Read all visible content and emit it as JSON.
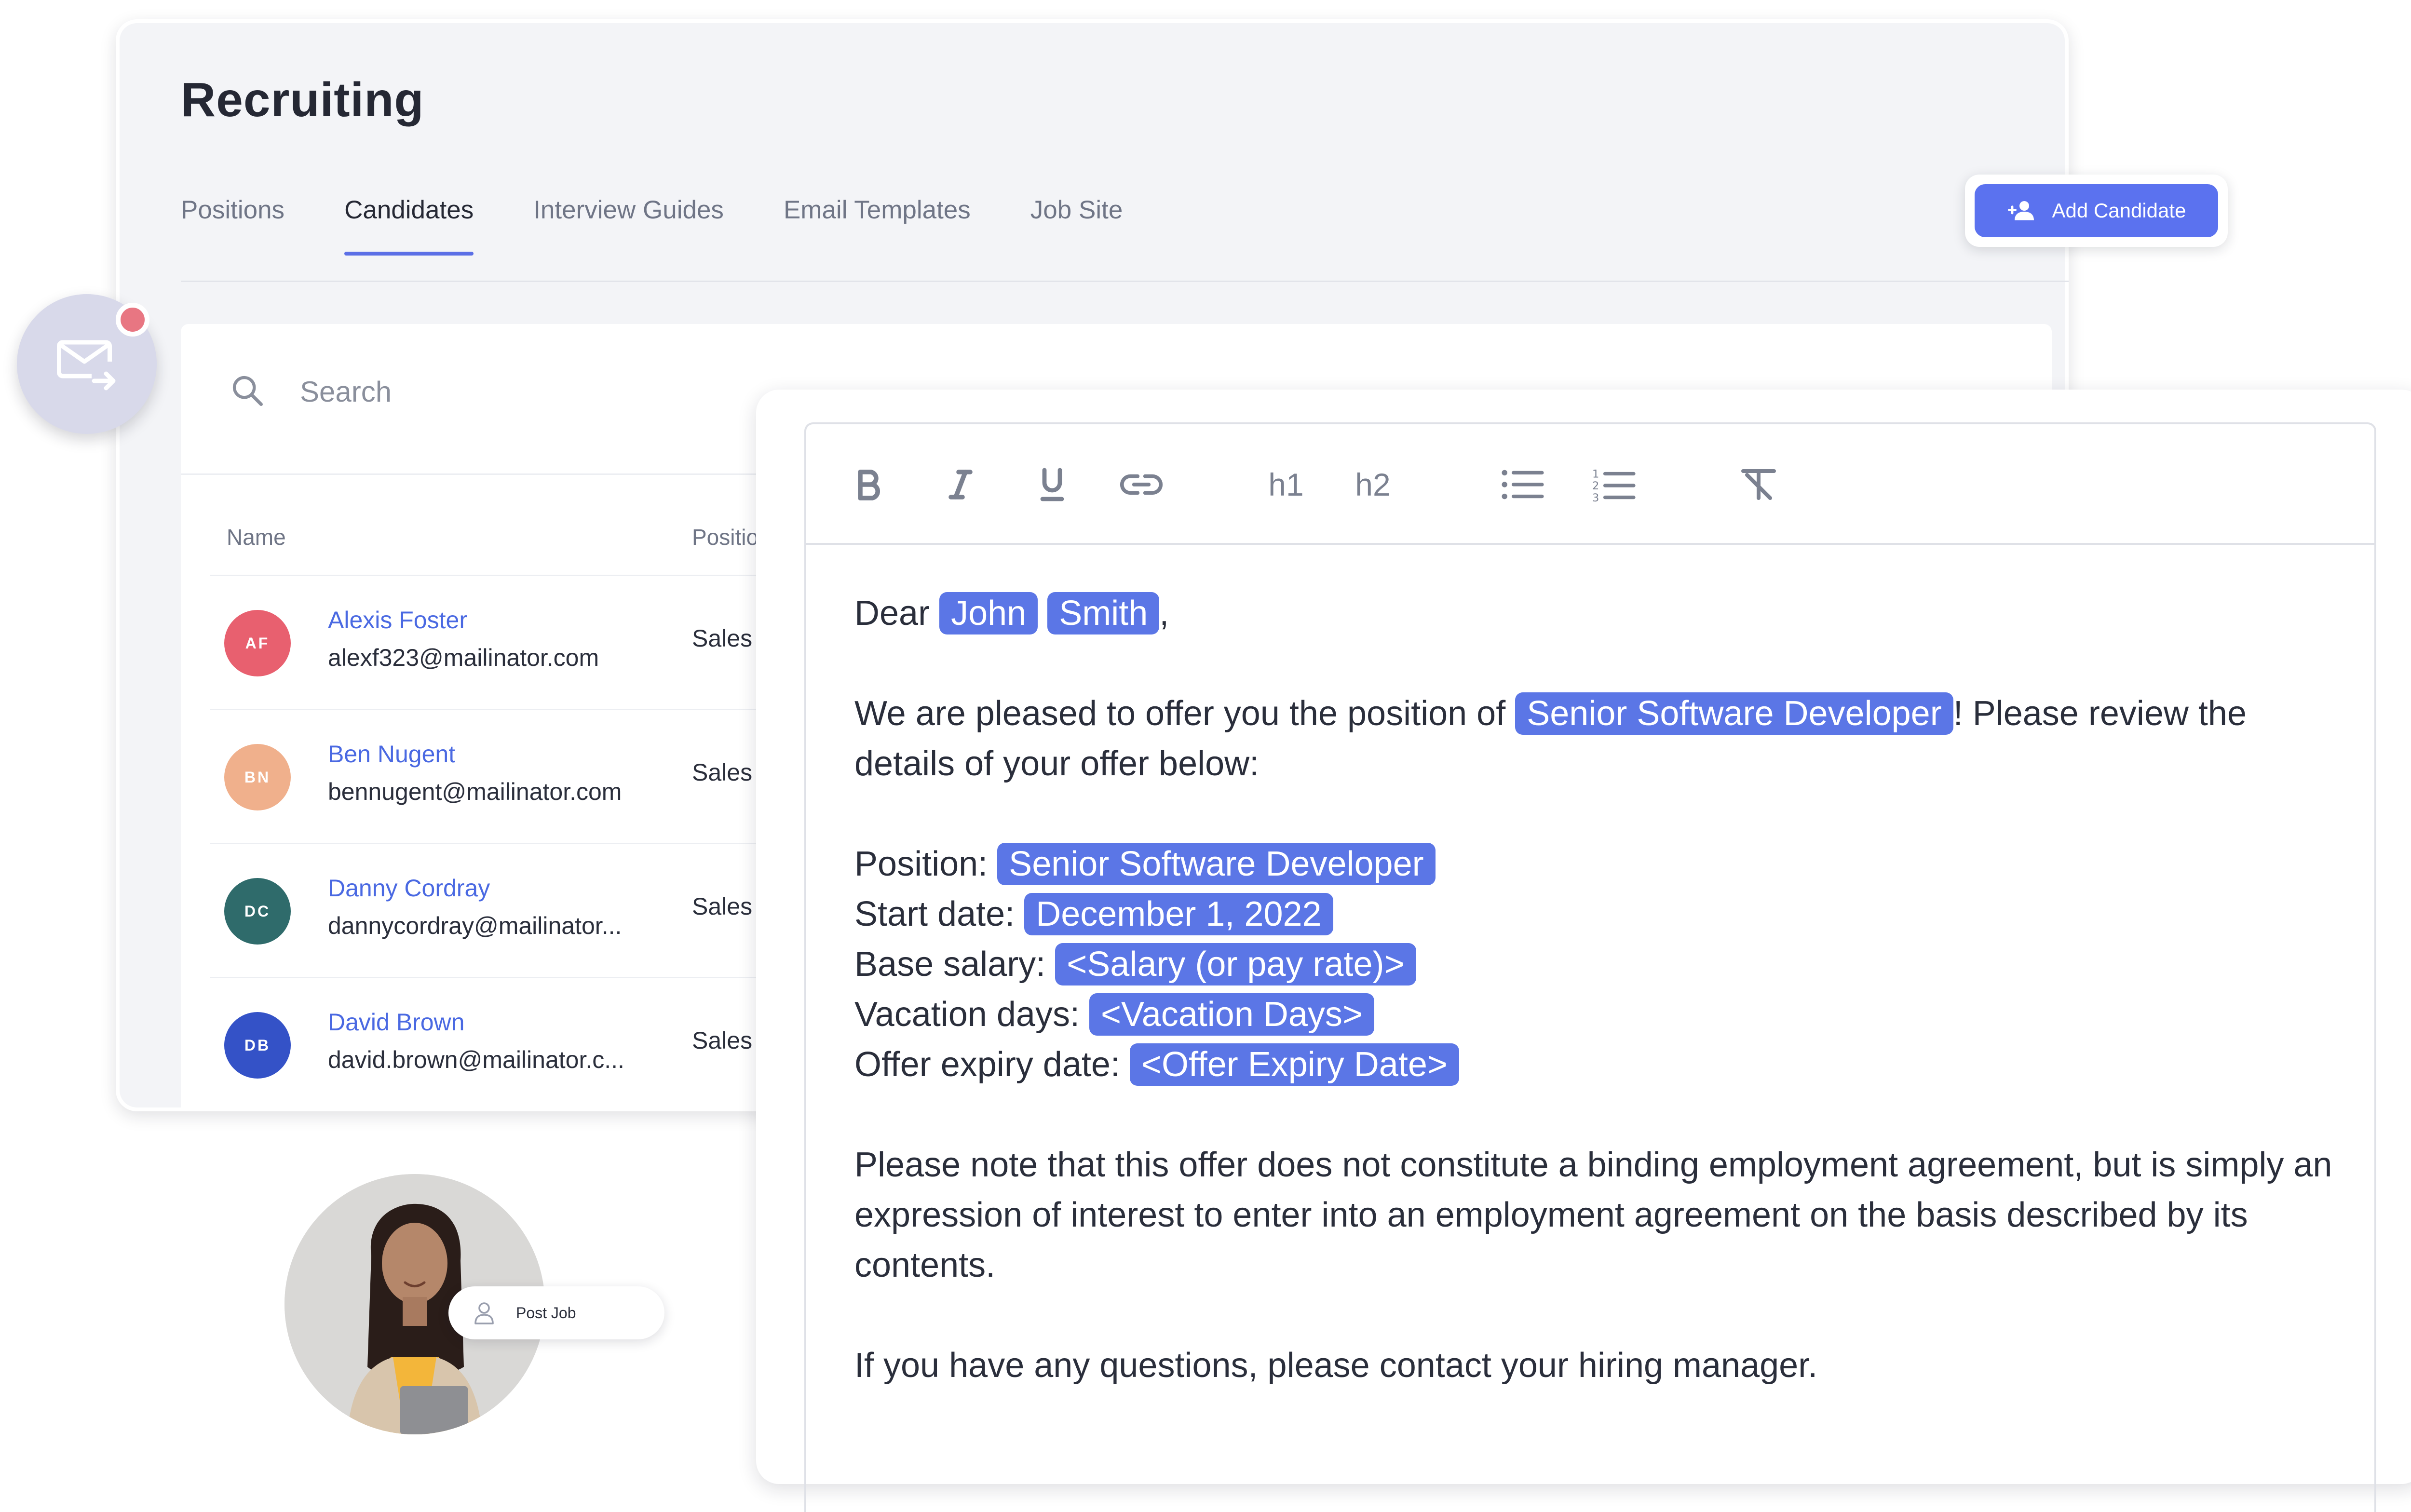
{
  "app": {
    "title": "Recruiting"
  },
  "tabs": [
    {
      "label": "Positions"
    },
    {
      "label": "Candidates",
      "active": true
    },
    {
      "label": "Interview Guides"
    },
    {
      "label": "Email Templates"
    },
    {
      "label": "Job Site"
    }
  ],
  "actions": {
    "add_candidate_label": "Add Candidate"
  },
  "search": {
    "placeholder": "Search"
  },
  "table": {
    "columns": {
      "name": "Name",
      "position": "Position"
    },
    "rows": [
      {
        "initials": "AF",
        "name": "Alexis Foster",
        "email": "alexf323@mailinator.com",
        "position": "Sales Rep",
        "avatar_color": "#e8606f"
      },
      {
        "initials": "BN",
        "name": "Ben Nugent",
        "email": "bennugent@mailinator.com",
        "position": "Sales Rep",
        "avatar_color": "#f0b08c"
      },
      {
        "initials": "DC",
        "name": "Danny Cordray",
        "email": "dannycordray@mailinator...",
        "position": "Sales Rep",
        "avatar_color": "#2f6b6b"
      },
      {
        "initials": "DB",
        "name": "David Brown",
        "email": "david.brown@mailinator.c...",
        "position": "Sales Rep",
        "avatar_color": "#3452c7"
      }
    ]
  },
  "chip": {
    "post_job_label": "Post Job"
  },
  "editor": {
    "toolbar": {
      "bold": "B",
      "italic": "I",
      "underline": "U",
      "link": "link",
      "h1": "h1",
      "h2": "h2",
      "bullet_list": "bullets",
      "ordered_list": "numbers",
      "clear_format": "clear"
    },
    "greeting": "Dear",
    "first_name": "John",
    "last_name": "Smith",
    "greeting_punct": ",",
    "offer_intro_1": "We are pleased to offer you the position of",
    "position_tag": "Senior Software Developer",
    "offer_intro_2": "! Please review the details of your offer below:",
    "details": {
      "position_label": "Position:",
      "position_value": "Senior Software Developer",
      "start_label": "Start date:",
      "start_value": "December 1, 2022",
      "salary_label": "Base salary:",
      "salary_value": "<Salary (or pay rate)>",
      "vacation_label": "Vacation days:",
      "vacation_value": "<Vacation Days>",
      "expiry_label": "Offer expiry date:",
      "expiry_value": "<Offer Expiry Date>"
    },
    "note": "Please note that this offer does not constitute a binding employment agreement, but is simply an expression of interest to enter into an employment agreement on the basis described by its contents.",
    "closing": "If you have any questions, please contact your hiring manager."
  },
  "colors": {
    "accent": "#5b72ef",
    "tag": "#5b76e6",
    "link": "#4a69e2",
    "notification": "#e87682"
  },
  "icons": {
    "search": "search-icon",
    "add_user": "add-user-icon",
    "mail": "mail-forward-icon",
    "person": "person-icon"
  }
}
